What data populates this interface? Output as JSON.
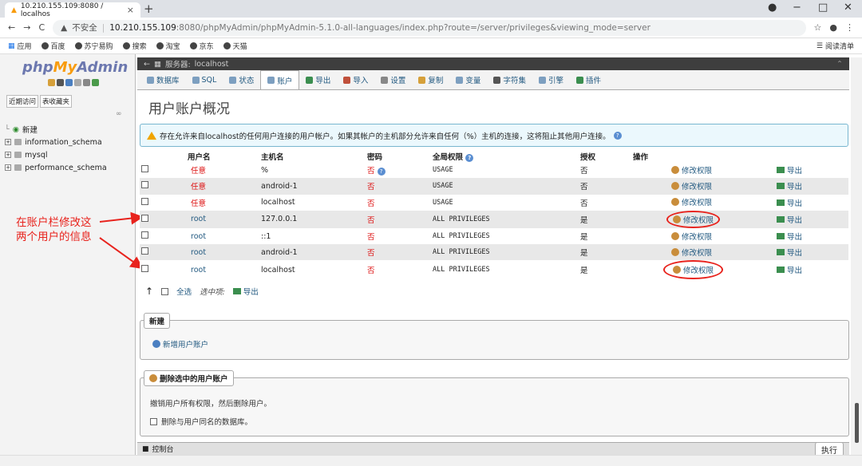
{
  "browser": {
    "tab_title": "10.210.155.109:8080 / localhos",
    "url_warning": "不安全",
    "url_host": "10.210.155.109",
    "url_rest": ":8080/phpMyAdmin/phpMyAdmin-5.1.0-all-languages/index.php?route=/server/privileges&viewing_mode=server"
  },
  "bookmarks": {
    "items": [
      "应用",
      "百度",
      "苏宁易购",
      "搜索",
      "淘宝",
      "京东",
      "天猫"
    ],
    "reading_list": "阅读清单"
  },
  "sidebar": {
    "logo_php": "php",
    "logo_my": "My",
    "logo_admin": "Admin",
    "tab_recent": "近期访问",
    "tab_fav": "表收藏夹",
    "new_label": "新建",
    "databases": [
      "information_schema",
      "mysql",
      "performance_schema"
    ]
  },
  "annotation": {
    "line1": "在账户栏修改这",
    "line2": "两个用户的信息"
  },
  "server": {
    "label": "服务器:",
    "name": "localhost"
  },
  "tabs": [
    {
      "label": "数据库",
      "icon": "database-icon"
    },
    {
      "label": "SQL",
      "icon": "sql-icon"
    },
    {
      "label": "状态",
      "icon": "status-icon"
    },
    {
      "label": "账户",
      "icon": "accounts-icon"
    },
    {
      "label": "导出",
      "icon": "export-icon"
    },
    {
      "label": "导入",
      "icon": "import-icon"
    },
    {
      "label": "设置",
      "icon": "settings-icon"
    },
    {
      "label": "复制",
      "icon": "replication-icon"
    },
    {
      "label": "变量",
      "icon": "variables-icon"
    },
    {
      "label": "字符集",
      "icon": "charset-icon"
    },
    {
      "label": "引擎",
      "icon": "engines-icon"
    },
    {
      "label": "插件",
      "icon": "plugins-icon"
    }
  ],
  "page_title": "用户账户概况",
  "notice": "存在允许来自localhost的任何用户连接的用户帐户。如果其帐户的主机部分允许来自任何（%）主机的连接，这将阻止其他用户连接。",
  "table": {
    "headers": {
      "user": "用户名",
      "host": "主机名",
      "password": "密码",
      "privs": "全局权限",
      "grant": "授权",
      "action": "操作"
    },
    "rows": [
      {
        "user": "任意",
        "host": "%",
        "password": "否",
        "privs": "USAGE",
        "grant": "否",
        "edit": "修改权限",
        "export": "导出"
      },
      {
        "user": "任意",
        "host": "android-1",
        "password": "否",
        "privs": "USAGE",
        "grant": "否",
        "edit": "修改权限",
        "export": "导出"
      },
      {
        "user": "任意",
        "host": "localhost",
        "password": "否",
        "privs": "USAGE",
        "grant": "否",
        "edit": "修改权限",
        "export": "导出"
      },
      {
        "user": "root",
        "host": "127.0.0.1",
        "password": "否",
        "privs": "ALL PRIVILEGES",
        "grant": "是",
        "edit": "修改权限",
        "export": "导出"
      },
      {
        "user": "root",
        "host": "::1",
        "password": "否",
        "privs": "ALL PRIVILEGES",
        "grant": "是",
        "edit": "修改权限",
        "export": "导出"
      },
      {
        "user": "root",
        "host": "android-1",
        "password": "否",
        "privs": "ALL PRIVILEGES",
        "grant": "是",
        "edit": "修改权限",
        "export": "导出"
      },
      {
        "user": "root",
        "host": "localhost",
        "password": "否",
        "privs": "ALL PRIVILEGES",
        "grant": "是",
        "edit": "修改权限",
        "export": "导出"
      }
    ]
  },
  "bulk": {
    "check_all": "全选",
    "with_selected": "选中项:",
    "export": "导出"
  },
  "new_section": {
    "legend": "新建",
    "add_user": "新增用户账户"
  },
  "delete_section": {
    "legend": "删除选中的用户账户",
    "desc": "撤销用户所有权限，然后删除用户。",
    "drop_db": "删除与用户同名的数据库。"
  },
  "console": {
    "label": "控制台",
    "execute": "执行"
  }
}
